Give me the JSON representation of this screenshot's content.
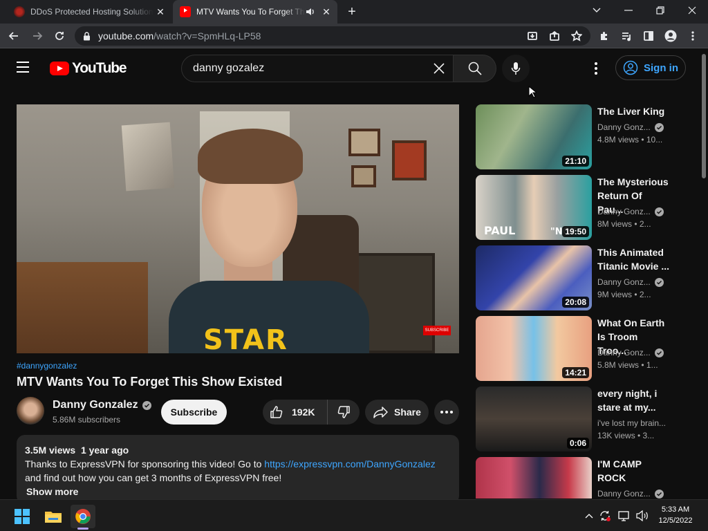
{
  "browser": {
    "tabs": [
      {
        "title": "DDoS Protected Hosting Solution",
        "active": false
      },
      {
        "title": "MTV Wants You To Forget This Show Existed",
        "active": true
      }
    ],
    "url_host": "youtube.com",
    "url_path": "/watch?v=SpmHLq-LP58"
  },
  "youtube": {
    "logo_text": "YouTube",
    "search_value": "danny gozalez",
    "signin_label": "Sign in"
  },
  "video": {
    "hashtag": "#dannygonzalez",
    "title": "MTV Wants You To Forget This Show Existed",
    "overlay_text": "STAR",
    "overlay_badge": "SUBSCRIBE",
    "channel": "Danny Gonzalez",
    "subscribers": "5.86M subscribers",
    "subscribe_label": "Subscribe",
    "likes": "192K",
    "share_label": "Share",
    "views": "3.5M views",
    "age": "1 year ago",
    "desc_line1_pre": "Thanks to ExpressVPN for sponsoring this video! Go to ",
    "desc_link": "https://expressvpn.com/DannyGonzalez",
    "desc_line2": "and find out how you can get 3 months of ExpressVPN free!",
    "show_more": "Show more"
  },
  "recommendations": [
    {
      "title_l1": "The Liver King",
      "title_l2": "",
      "channel": "Danny Gonz...",
      "meta": "4.8M views  • 10...",
      "duration": "21:10"
    },
    {
      "title_l1": "The Mysterious",
      "title_l2": "Return Of Pau...",
      "channel": "Danny Gonz...",
      "meta": "8M views  • 2...",
      "duration": "19:50",
      "thumb_text_1": "PAUL",
      "thumb_text_2": "\"NOT"
    },
    {
      "title_l1": "This Animated",
      "title_l2": "Titanic Movie ...",
      "channel": "Danny Gonz...",
      "meta": "9M views  • 2...",
      "duration": "20:08"
    },
    {
      "title_l1": "What On Earth",
      "title_l2": "Is Troom Troo...",
      "channel": "Danny Gonz...",
      "meta": "5.8M views  • 1...",
      "duration": "14:21"
    },
    {
      "title_l1": "every night, i",
      "title_l2": "stare at my...",
      "channel": "i've lost my brain...",
      "meta": "13K views  • 3...",
      "duration": "0:06"
    },
    {
      "title_l1": "I'M CAMP",
      "title_l2": "ROCK",
      "channel": "Danny Gonz...",
      "meta": "",
      "duration": ""
    }
  ],
  "taskbar": {
    "time": "5:33 AM",
    "date": "12/5/2022"
  },
  "colors": {
    "accent_link": "#3ea6ff",
    "youtube_red": "#ff0000",
    "page_bg": "#0f0f0f"
  }
}
